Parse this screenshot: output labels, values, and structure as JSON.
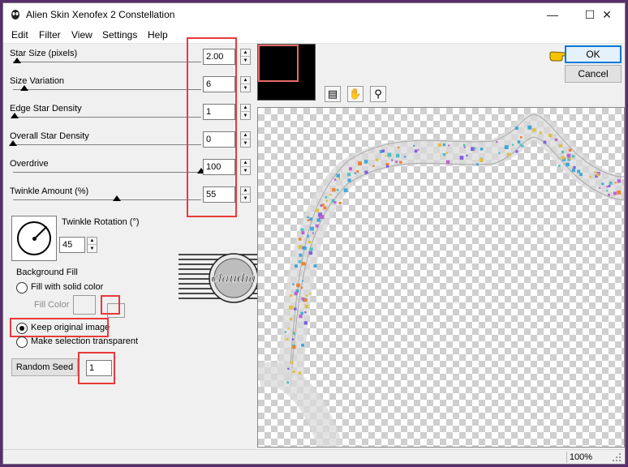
{
  "window": {
    "title": "Alien Skin Xenofex 2 Constellation"
  },
  "menu": [
    "Edit",
    "Filter",
    "View",
    "Settings",
    "Help"
  ],
  "sliders": [
    {
      "label": "Star Size (pixels)",
      "value": "2.00",
      "level": 0.02
    },
    {
      "label": "Size Variation",
      "value": "6",
      "level": 0.06
    },
    {
      "label": "Edge Star Density",
      "value": "1",
      "level": 0.01
    },
    {
      "label": "Overall Star Density",
      "value": "0",
      "level": 0.0
    },
    {
      "label": "Overdrive",
      "value": "100",
      "level": 1.0
    },
    {
      "label": "Twinkle Amount (%)",
      "value": "55",
      "level": 0.55
    }
  ],
  "twinkle_rotation": {
    "label": "Twinkle Rotation (°)",
    "value": "45"
  },
  "background_fill": {
    "title": "Background Fill",
    "options": [
      "Fill with solid color",
      "Keep original image",
      "Make selection transparent"
    ],
    "selected": "Keep original image",
    "fill_color_label": "Fill Color"
  },
  "random_seed": {
    "button_label": "Random Seed",
    "value": "1"
  },
  "watermark": {
    "text": "claudia"
  },
  "buttons": {
    "ok": "OK",
    "cancel": "Cancel"
  },
  "status": {
    "zoom": "100%"
  },
  "icons": [
    "app-icon",
    "minimize-icon",
    "maximize-icon",
    "close-icon",
    "zoom-tool-icon",
    "hand-tool-icon",
    "magnifier-icon",
    "pointing-hand-icon",
    "resize-grip-icon"
  ],
  "colors": {
    "highlight": "#e83a3a",
    "ok_border": "#0078d7",
    "desktop": "#5a2d6e"
  }
}
